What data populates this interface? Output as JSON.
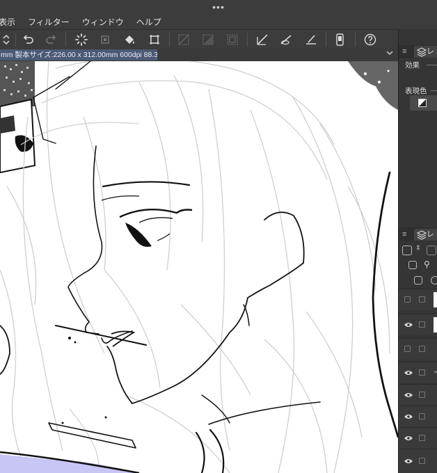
{
  "window": {
    "dots": "•••"
  },
  "menu": {
    "items": [
      "表示",
      "フィルター",
      "ウィンドウ",
      "ヘルプ"
    ]
  },
  "toolbar": {
    "icons": [
      "stepper-icon",
      "undo-icon",
      "redo-icon",
      "loading-icon",
      "clear-layer-icon",
      "fill-icon",
      "transform-icon",
      "select-transparent-icon",
      "select-inverse-icon",
      "select-all-icon",
      "snap-ruler-icon",
      "snap-special-ruler-icon",
      "snap-grid-icon",
      "device-icon",
      "help-icon"
    ]
  },
  "document": {
    "info": "mm 製本サイズ:226.00 x 312.00mm 600dpi 88.3%)"
  },
  "right_panel": {
    "top_tab_label": "レ",
    "effect_label": "効果",
    "expression_color_label": "表現色",
    "layer_tab_label": "レ",
    "layer_header_glyph": "≡"
  },
  "colors": {
    "ui_bg": "#3c3c3c",
    "panel_bg": "#353535",
    "doc_tab": "#4b5a74",
    "canvas_bg": "#ffffff",
    "sketch_gray": "#c8c8c8",
    "ink": "#111111",
    "accent_lavender": "#c7c6f5"
  }
}
